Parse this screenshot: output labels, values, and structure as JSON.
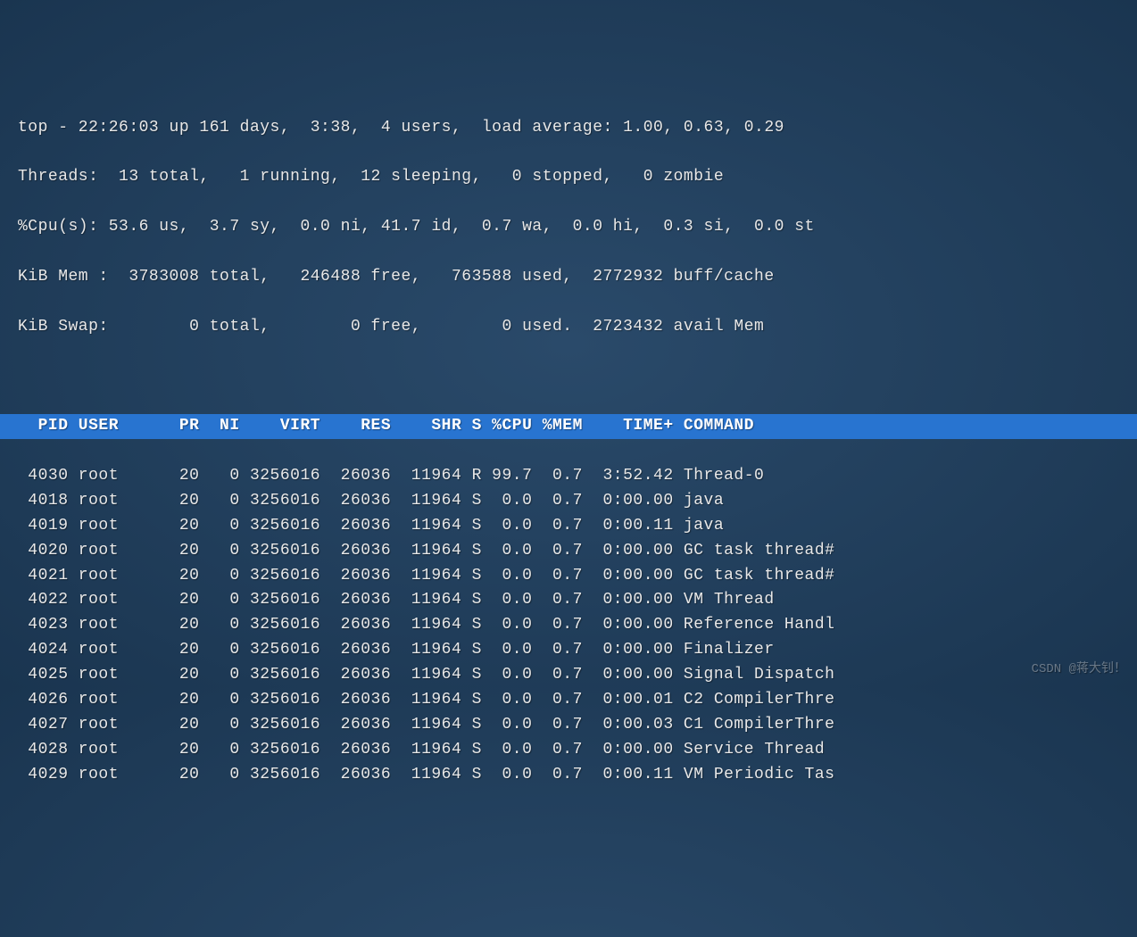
{
  "summary": {
    "line1": "top - 22:26:03 up 161 days,  3:38,  4 users,  load average: 1.00, 0.63, 0.29",
    "line2": "Threads:  13 total,   1 running,  12 sleeping,   0 stopped,   0 zombie",
    "line3": "%Cpu(s): 53.6 us,  3.7 sy,  0.0 ni, 41.7 id,  0.7 wa,  0.0 hi,  0.3 si,  0.0 st",
    "line4": "KiB Mem :  3783008 total,   246488 free,   763588 used,  2772932 buff/cache",
    "line5": "KiB Swap:        0 total,        0 free,        0 used.  2723432 avail Mem"
  },
  "headers": [
    "PID",
    "USER",
    "PR",
    "NI",
    "VIRT",
    "RES",
    "SHR",
    "S",
    "%CPU",
    "%MEM",
    "TIME+",
    "COMMAND"
  ],
  "processes": [
    {
      "pid": "4030",
      "user": "root",
      "pr": "20",
      "ni": "0",
      "virt": "3256016",
      "res": "26036",
      "shr": "11964",
      "s": "R",
      "cpu": "99.7",
      "mem": "0.7",
      "time": "3:52.42",
      "command": "Thread-0"
    },
    {
      "pid": "4018",
      "user": "root",
      "pr": "20",
      "ni": "0",
      "virt": "3256016",
      "res": "26036",
      "shr": "11964",
      "s": "S",
      "cpu": "0.0",
      "mem": "0.7",
      "time": "0:00.00",
      "command": "java"
    },
    {
      "pid": "4019",
      "user": "root",
      "pr": "20",
      "ni": "0",
      "virt": "3256016",
      "res": "26036",
      "shr": "11964",
      "s": "S",
      "cpu": "0.0",
      "mem": "0.7",
      "time": "0:00.11",
      "command": "java"
    },
    {
      "pid": "4020",
      "user": "root",
      "pr": "20",
      "ni": "0",
      "virt": "3256016",
      "res": "26036",
      "shr": "11964",
      "s": "S",
      "cpu": "0.0",
      "mem": "0.7",
      "time": "0:00.00",
      "command": "GC task thread#"
    },
    {
      "pid": "4021",
      "user": "root",
      "pr": "20",
      "ni": "0",
      "virt": "3256016",
      "res": "26036",
      "shr": "11964",
      "s": "S",
      "cpu": "0.0",
      "mem": "0.7",
      "time": "0:00.00",
      "command": "GC task thread#"
    },
    {
      "pid": "4022",
      "user": "root",
      "pr": "20",
      "ni": "0",
      "virt": "3256016",
      "res": "26036",
      "shr": "11964",
      "s": "S",
      "cpu": "0.0",
      "mem": "0.7",
      "time": "0:00.00",
      "command": "VM Thread"
    },
    {
      "pid": "4023",
      "user": "root",
      "pr": "20",
      "ni": "0",
      "virt": "3256016",
      "res": "26036",
      "shr": "11964",
      "s": "S",
      "cpu": "0.0",
      "mem": "0.7",
      "time": "0:00.00",
      "command": "Reference Handl"
    },
    {
      "pid": "4024",
      "user": "root",
      "pr": "20",
      "ni": "0",
      "virt": "3256016",
      "res": "26036",
      "shr": "11964",
      "s": "S",
      "cpu": "0.0",
      "mem": "0.7",
      "time": "0:00.00",
      "command": "Finalizer"
    },
    {
      "pid": "4025",
      "user": "root",
      "pr": "20",
      "ni": "0",
      "virt": "3256016",
      "res": "26036",
      "shr": "11964",
      "s": "S",
      "cpu": "0.0",
      "mem": "0.7",
      "time": "0:00.00",
      "command": "Signal Dispatch"
    },
    {
      "pid": "4026",
      "user": "root",
      "pr": "20",
      "ni": "0",
      "virt": "3256016",
      "res": "26036",
      "shr": "11964",
      "s": "S",
      "cpu": "0.0",
      "mem": "0.7",
      "time": "0:00.01",
      "command": "C2 CompilerThre"
    },
    {
      "pid": "4027",
      "user": "root",
      "pr": "20",
      "ni": "0",
      "virt": "3256016",
      "res": "26036",
      "shr": "11964",
      "s": "S",
      "cpu": "0.0",
      "mem": "0.7",
      "time": "0:00.03",
      "command": "C1 CompilerThre"
    },
    {
      "pid": "4028",
      "user": "root",
      "pr": "20",
      "ni": "0",
      "virt": "3256016",
      "res": "26036",
      "shr": "11964",
      "s": "S",
      "cpu": "0.0",
      "mem": "0.7",
      "time": "0:00.00",
      "command": "Service Thread"
    },
    {
      "pid": "4029",
      "user": "root",
      "pr": "20",
      "ni": "0",
      "virt": "3256016",
      "res": "26036",
      "shr": "11964",
      "s": "S",
      "cpu": "0.0",
      "mem": "0.7",
      "time": "0:00.11",
      "command": "VM Periodic Tas"
    }
  ],
  "watermark": "CSDN @蒋大钊！"
}
